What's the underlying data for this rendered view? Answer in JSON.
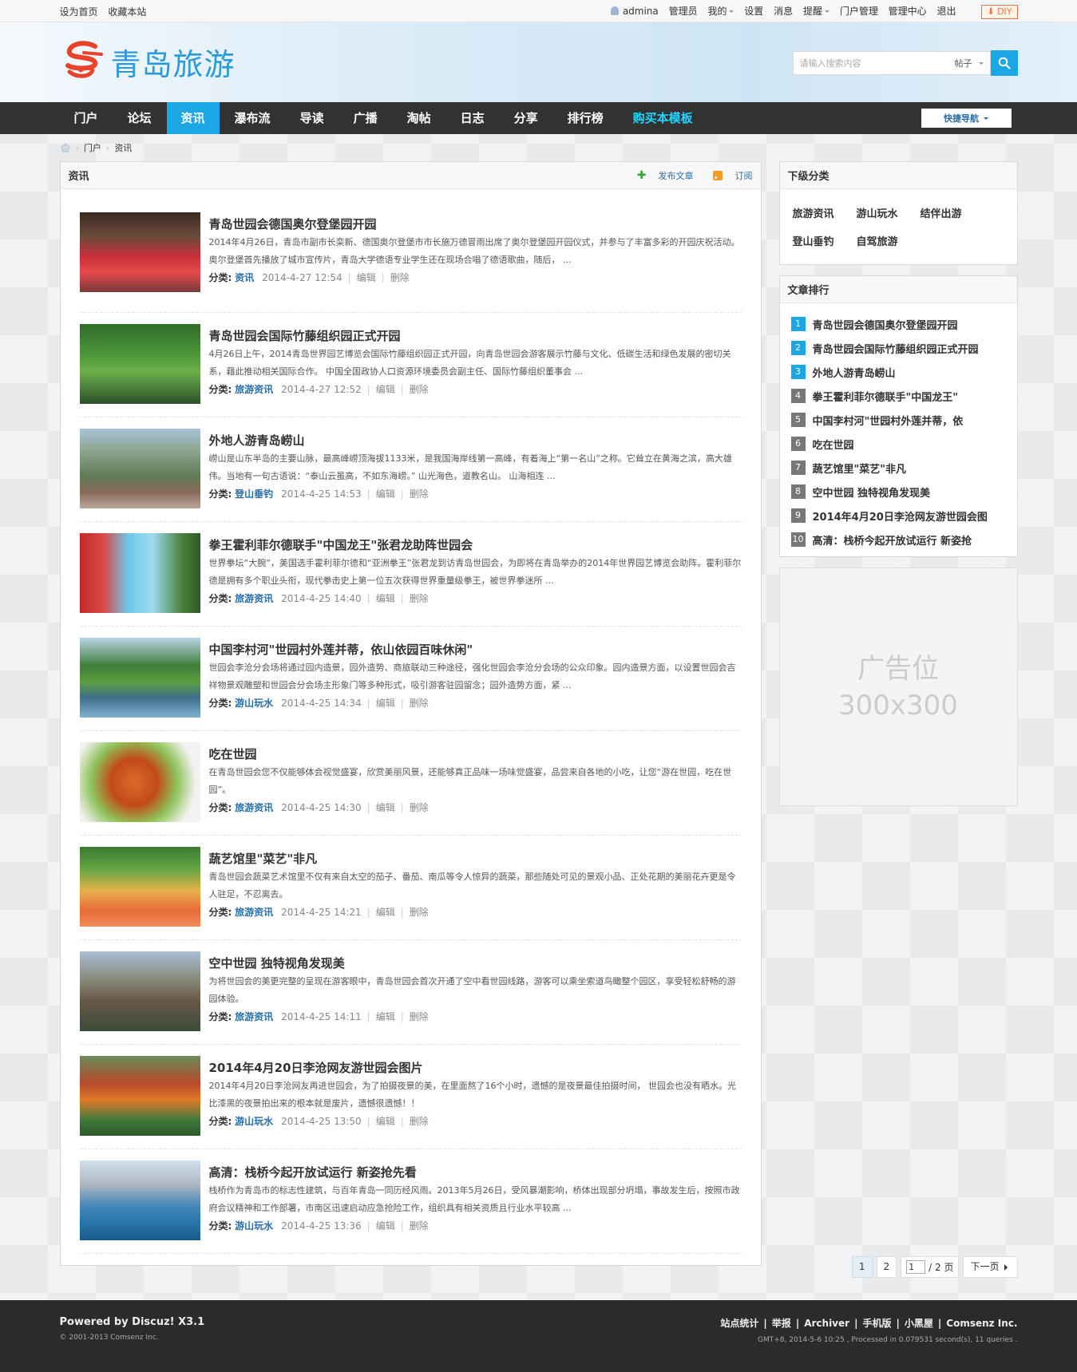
{
  "topbar": {
    "left": [
      "设为首页",
      "收藏本站"
    ],
    "username": "admina",
    "links": [
      "管理员",
      "我的",
      "设置",
      "消息",
      "提醒",
      "门户管理",
      "管理中心",
      "退出"
    ],
    "diy": "DIY"
  },
  "header": {
    "logo_text": "青岛旅游",
    "search_placeholder": "请输入搜索内容",
    "search_type": "帖子"
  },
  "nav": {
    "items": [
      "门户",
      "论坛",
      "资讯",
      "瀑布流",
      "导读",
      "广播",
      "淘帖",
      "日志",
      "分享",
      "排行榜",
      "购买本模板"
    ],
    "active": "资讯",
    "quick_nav": "快捷导航"
  },
  "breadcrumb": [
    "门户",
    "资讯"
  ],
  "main": {
    "title": "资讯",
    "publish": "发布文章",
    "subscribe": "订阅",
    "cat_label": "分类:",
    "edit": "编辑",
    "delete": "删除",
    "articles": [
      {
        "title": "青岛世园会德国奥尔登堡园开园",
        "summary": "2014年4月26日，青岛市副市长栾新、德国奥尔登堡市市长施万德冒雨出席了奥尔登堡园开园仪式，并参与了丰富多彩的开园庆祝活动。 奥尔登堡首先播放了城市宣传片，青岛大学德语专业学生还在现场合唱了德语歌曲，随后， ...",
        "category": "资讯",
        "time": "2014-4-27 12:54",
        "thumb": "photo-ceremony"
      },
      {
        "title": "青岛世园会国际竹藤组织园正式开园",
        "summary": "4月26日上午，2014青岛世界园艺博览会国际竹藤组织园正式开园，向青岛世园会游客展示竹藤与文化、低碳生活和绿色发展的密切关系，藉此推动相关国际合作。 中国全国政协人口资源环境委员会副主任、国际竹藤组织董事会 ...",
        "category": "旅游资讯",
        "time": "2014-4-27 12:52",
        "thumb": "photo-green-stage"
      },
      {
        "title": "外地人游青岛崂山",
        "summary": "崂山是山东半岛的主要山脉，最高峰崂顶海拔1133米，是我国海岸线第一高峰，有着海上“第一名山”之称。它耸立在黄海之滨，高大雄伟。当地有一句古语说：“泰山云虽高，不如东海崂。” 山光海色，道教名山。 山海相连 ...",
        "category": "登山垂钓",
        "time": "2014-4-25 14:53",
        "thumb": "photo-mountain"
      },
      {
        "title": "拳王霍利菲尔德联手\"中国龙王\"张君龙助阵世园会",
        "summary": "世界拳坛“大腕”，美国选手霍利菲尔德和“亚洲拳王”张君龙到访青岛世园会，为即将在青岛举办的2014年世界园艺博览会助阵。霍利菲尔德是拥有多个职业头衔，现代拳击史上第一位五次获得世界重量级拳王，被世界拳迷所 ...",
        "category": "旅游资讯",
        "time": "2014-4-25 14:40",
        "thumb": "photo-mascot"
      },
      {
        "title": "中国李村河\"世园村外莲并蒂，依山依园百味休闲\"",
        "summary": "世园会李沧分会场将通过园内造景，园外造势、商旅联动三种途径，强化世园会李沧分会场的公众印象。园内造景方面，以设置世园会吉祥物景观雕塑和世园会分会场主形象门等多种形式，吸引游客驻园留念；园外造势方面，紧 ...",
        "category": "游山玩水",
        "time": "2014-4-25 14:34",
        "thumb": "photo-lake"
      },
      {
        "title": "吃在世园",
        "summary": "在青岛世园会您不仅能够体会视觉盛宴，欣赏美丽风景，还能够真正品味一场味觉盛宴，品尝来自各地的小吃，让您“游在世园，吃在世园”。",
        "category": "旅游资讯",
        "time": "2014-4-25 14:30",
        "thumb": "photo-food"
      },
      {
        "title": "蔬艺馆里\"菜艺\"非凡",
        "summary": "青岛世园会蔬菜艺术馆里不仅有来自太空的茄子、番茄、南瓜等令人惊异的蔬菜，那些随处可见的景观小品、正处花期的美丽花卉更是令人驻足，不忍离去。",
        "category": "旅游资讯",
        "time": "2014-4-25 14:21",
        "thumb": "photo-veg"
      },
      {
        "title": "空中世园 独特视角发现美",
        "summary": "为将世园会的美更完整的呈现在游客眼中，青岛世园会首次开通了空中看世园线路，游客可以乘坐索道鸟瞰整个园区，享受轻松舒畅的游园体验。",
        "category": "旅游资讯",
        "time": "2014-4-25 14:11",
        "thumb": "photo-cable"
      },
      {
        "title": "2014年4月20日李沧网友游世园会图片",
        "summary": "2014年4月20日李沧网友再进世园会，为了拍摄夜景的美，在里面熬了16个小时，遗憾的是夜景最佳拍摄时间， 世园会也没有晒水。光比漆黑的夜景拍出来的根本就是废片，遗憾很遗憾！！",
        "category": "游山玩水",
        "time": "2014-4-25 13:50",
        "thumb": "photo-garden"
      },
      {
        "title": "高清：栈桥今起开放试运行 新姿抢先看",
        "summary": "栈桥作为青岛市的标志性建筑，与百年青岛一同历经风雨。2013年5月26日，受风暴潮影响，桥体出现部分坍塌，事故发生后，按照市政府会议精神和工作部署，市南区迅速启动应急抢险工作，组织具有相关资质且行业水平较高 ...",
        "category": "游山玩水",
        "time": "2014-4-25 13:36",
        "thumb": "photo-pier"
      }
    ]
  },
  "pager": {
    "pages": [
      "1",
      "2"
    ],
    "current": "1",
    "input": "1",
    "total": "/ 2 页",
    "next": "下一页"
  },
  "side": {
    "subcat_title": "下级分类",
    "subcats": [
      "旅游资讯",
      "游山玩水",
      "结伴出游",
      "登山垂钓",
      "自驾旅游"
    ],
    "rank_title": "文章排行",
    "rank": [
      {
        "n": "1",
        "title": "青岛世园会德国奥尔登堡园开园"
      },
      {
        "n": "2",
        "title": "青岛世园会国际竹藤组织园正式开园"
      },
      {
        "n": "3",
        "title": "外地人游青岛崂山"
      },
      {
        "n": "4",
        "title": "拳王霍利菲尔德联手\"中国龙王\""
      },
      {
        "n": "5",
        "title": "中国李村河\"世园村外莲并蒂，依"
      },
      {
        "n": "6",
        "title": "吃在世园"
      },
      {
        "n": "7",
        "title": "蔬艺馆里\"菜艺\"非凡"
      },
      {
        "n": "8",
        "title": "空中世园 独特视角发现美"
      },
      {
        "n": "9",
        "title": "2014年4月20日李沧网友游世园会图"
      },
      {
        "n": "10",
        "title": "高清：栈桥今起开放试运行 新姿抢"
      }
    ],
    "ad_line1": "广告位",
    "ad_line2": "300x300"
  },
  "footer": {
    "powered": "Powered by Discuz! X3.1",
    "copyright": "© 2001-2013 Comsenz Inc.",
    "links": [
      "站点统计",
      "举报",
      "Archiver",
      "手机版",
      "小黑屋",
      "Comsenz Inc."
    ],
    "info": "GMT+8, 2014-5-6 10:25 , Processed in 0.079531 second(s), 11 queries ."
  },
  "colors": {
    "accent": "#1aa7e3",
    "nav_bg": "#323232",
    "link": "#2b6ea5",
    "logo_red": "#e8412c"
  }
}
